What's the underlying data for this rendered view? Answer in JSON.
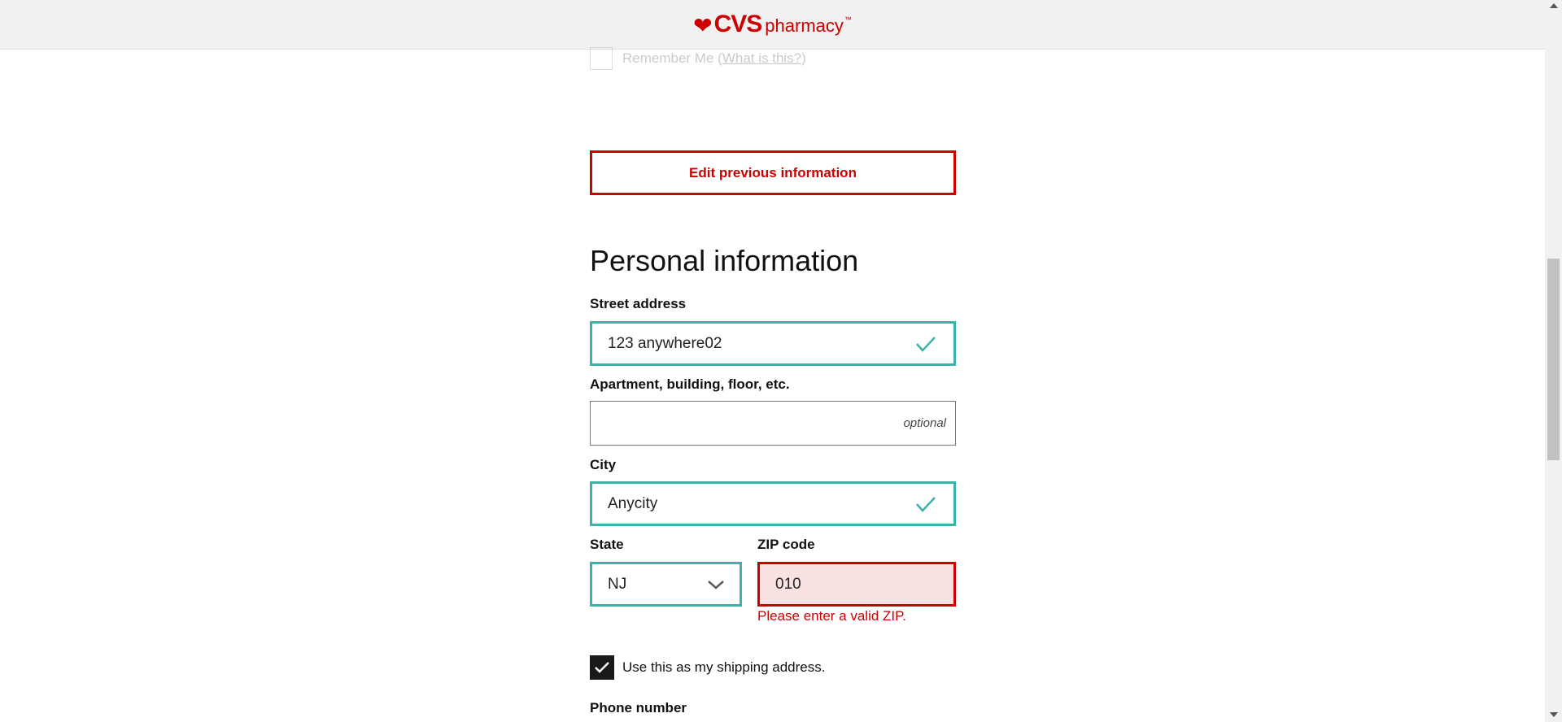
{
  "header": {
    "logo_heart": "❤",
    "logo_brand": "CVS",
    "logo_sub": "pharmacy",
    "logo_tm": "™",
    "brand_color": "#cc0000"
  },
  "remember": {
    "label": "Remember Me",
    "paren_open": "(",
    "link": "What is this?",
    "paren_close": ")"
  },
  "edit_button": "Edit previous information",
  "section_title": "Personal information",
  "fields": {
    "street": {
      "label": "Street address",
      "value": "123 anywhere02",
      "status": "valid"
    },
    "apartment": {
      "label": "Apartment, building, floor, etc.",
      "value": "",
      "hint": "optional"
    },
    "city": {
      "label": "City",
      "value": "Anycity",
      "status": "valid"
    },
    "state": {
      "label": "State",
      "value": "NJ",
      "status": "valid"
    },
    "zip": {
      "label": "ZIP code",
      "value": "010",
      "status": "error",
      "error": "Please enter a valid ZIP."
    }
  },
  "shipping_checkbox": {
    "label": "Use this as my shipping address.",
    "checked": true
  },
  "phone": {
    "label": "Phone number"
  },
  "colors": {
    "valid": "#3bb3a6",
    "error": "#cc0000",
    "error_bg": "#fae2e3"
  }
}
